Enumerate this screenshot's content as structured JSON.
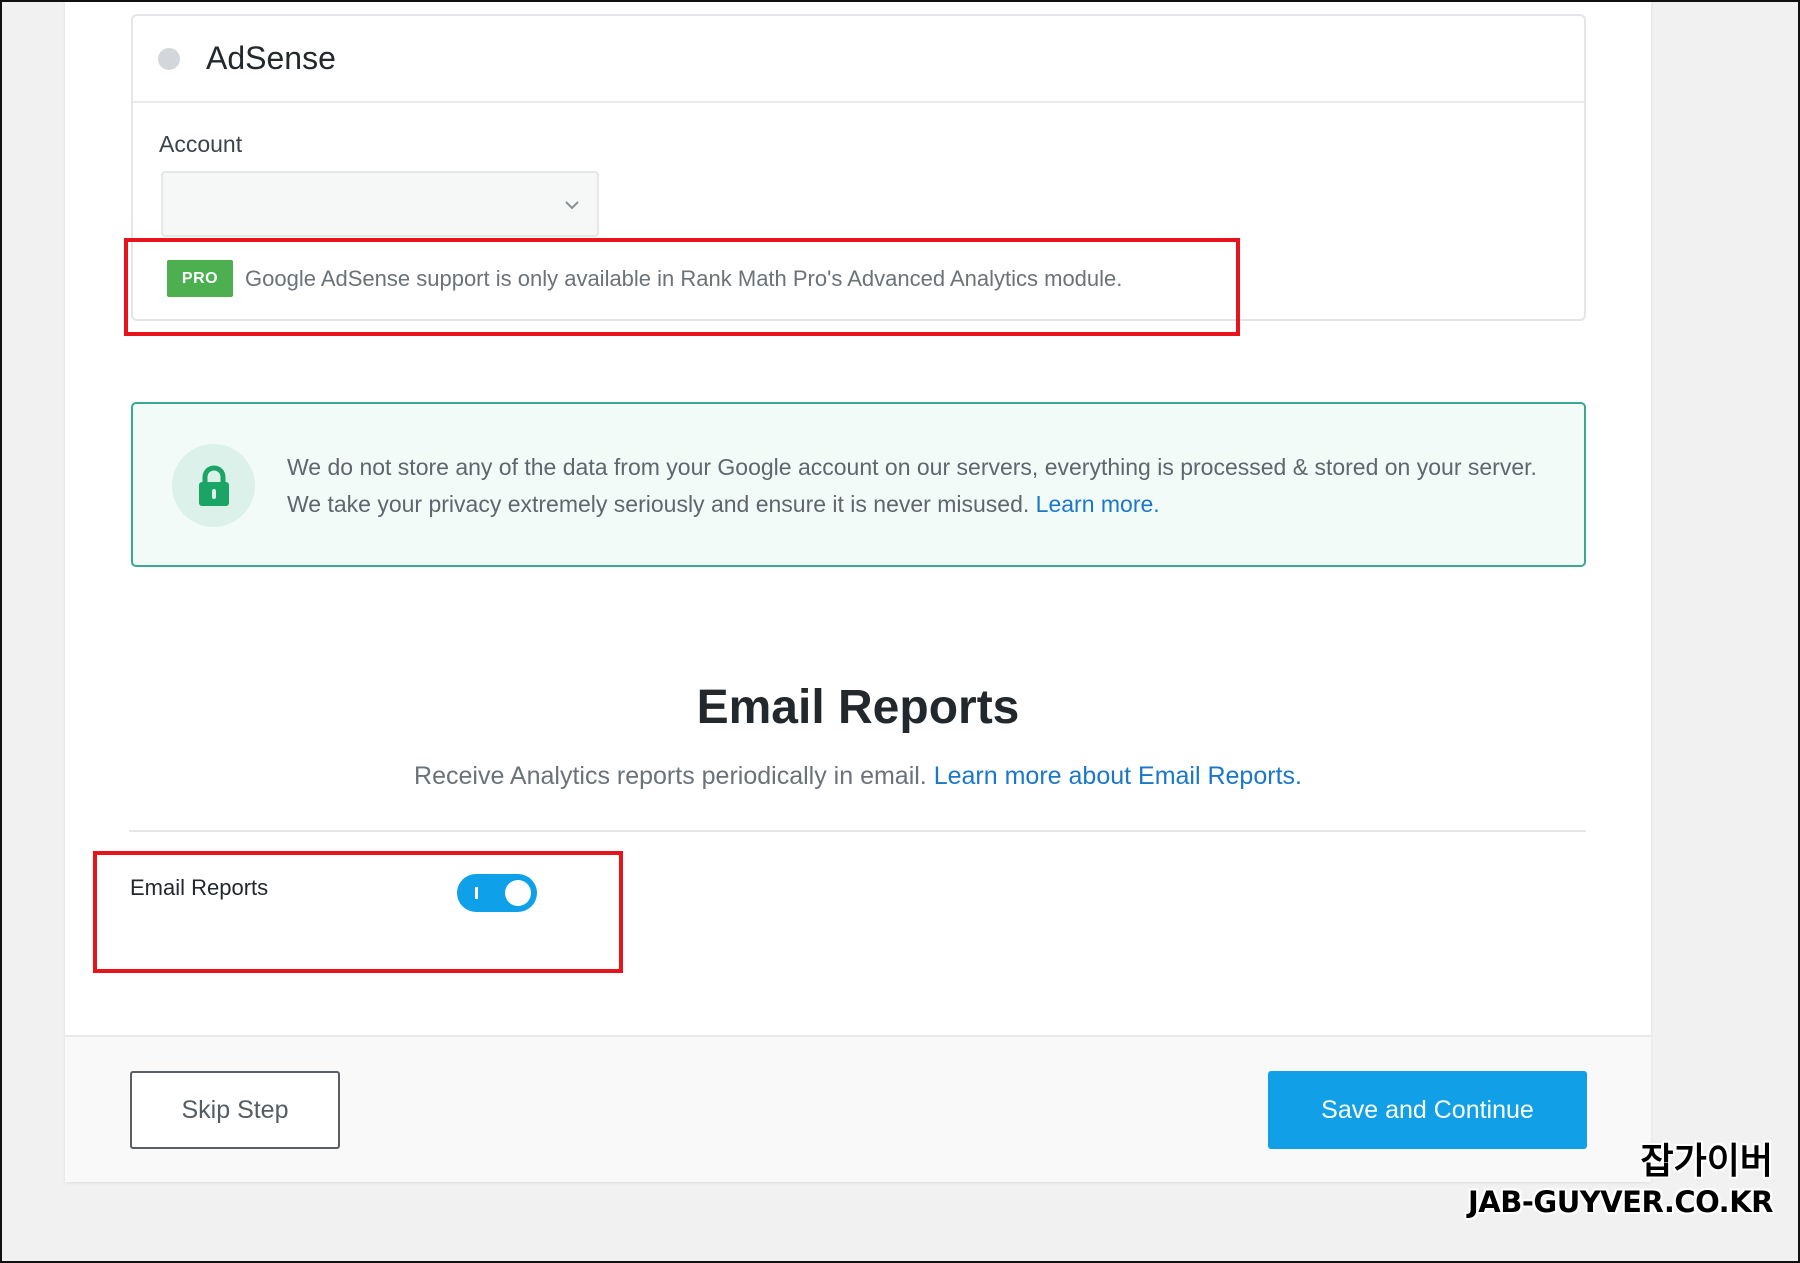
{
  "adsense": {
    "title": "AdSense",
    "account_label": "Account",
    "account_value": "",
    "pro_badge": "PRO",
    "pro_notice": "Google AdSense support is only available in Rank Math Pro's Advanced Analytics module."
  },
  "privacy": {
    "text": "We do not store any of the data from your Google account on our servers, everything is processed & stored on your server. We take your privacy extremely seriously and ensure it is never misused.",
    "link": "Learn more."
  },
  "email_reports": {
    "title": "Email Reports",
    "subtitle": "Receive Analytics reports periodically in email.",
    "subtitle_link": "Learn more about Email Reports.",
    "toggle_label": "Email Reports",
    "toggle_on": true
  },
  "footer": {
    "skip_label": "Skip Step",
    "save_label": "Save and Continue"
  },
  "watermark": {
    "korean": "잡가이버",
    "domain": "JAB-GUYVER.CO.KR"
  },
  "colors": {
    "accent": "#11a0e8",
    "pro_green": "#4caf50",
    "privacy_border": "#3aa892",
    "highlight_red": "#e8141b"
  }
}
